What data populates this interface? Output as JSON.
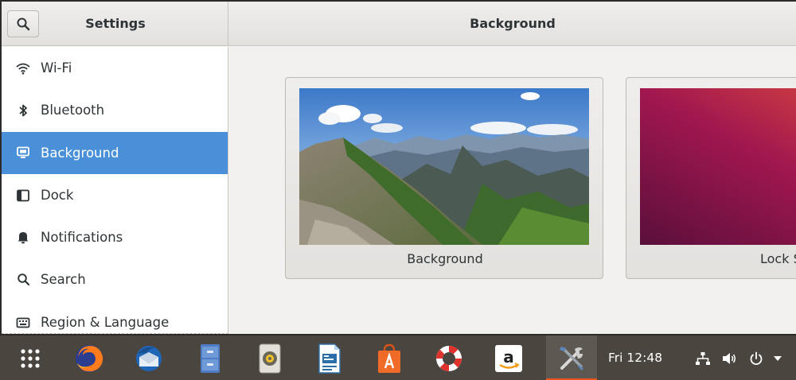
{
  "header": {
    "settings_title": "Settings",
    "panel_title": "Background"
  },
  "sidebar": {
    "items": [
      {
        "label": "Wi-Fi",
        "icon": "wifi-icon"
      },
      {
        "label": "Bluetooth",
        "icon": "bluetooth-icon"
      },
      {
        "label": "Background",
        "icon": "display-icon",
        "selected": true
      },
      {
        "label": "Dock",
        "icon": "dock-icon"
      },
      {
        "label": "Notifications",
        "icon": "bell-icon"
      },
      {
        "label": "Search",
        "icon": "search-icon"
      },
      {
        "label": "Region & Language",
        "icon": "keyboard-icon"
      }
    ]
  },
  "content": {
    "cards": [
      {
        "label": "Background",
        "image": "mountain-landscape"
      },
      {
        "label": "Lock Sc",
        "image": "ubuntu-purple-wallpaper"
      }
    ]
  },
  "dock": {
    "apps": [
      {
        "name": "show-applications",
        "icon": "grid-icon"
      },
      {
        "name": "firefox",
        "icon": "firefox-icon"
      },
      {
        "name": "thunderbird",
        "icon": "thunderbird-icon"
      },
      {
        "name": "files",
        "icon": "file-cabinet-icon"
      },
      {
        "name": "rhythmbox",
        "icon": "speaker-icon"
      },
      {
        "name": "libreoffice-writer",
        "icon": "writer-icon"
      },
      {
        "name": "ubuntu-software",
        "icon": "shopping-bag-icon"
      },
      {
        "name": "help",
        "icon": "lifebuoy-icon"
      },
      {
        "name": "amazon",
        "icon": "amazon-icon"
      },
      {
        "name": "settings",
        "icon": "tools-icon",
        "active": true
      }
    ],
    "clock": "Fri 12:48",
    "tray": [
      "network-icon",
      "volume-icon",
      "power-icon",
      "chevron-down-icon"
    ]
  },
  "colors": {
    "selected": "#4a90d9",
    "dock": "#4b453f",
    "active_indicator": "#e95420"
  }
}
